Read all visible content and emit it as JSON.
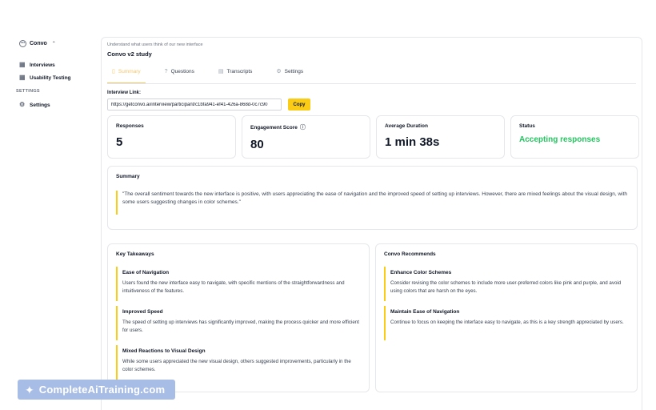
{
  "sidebar": {
    "workspace": "Convo",
    "nav": [
      {
        "label": "Interviews",
        "icon": "grid-icon"
      },
      {
        "label": "Usability Testing",
        "icon": "grid-icon"
      }
    ],
    "section_label": "SETTINGS",
    "settings_item": {
      "label": "Settings",
      "icon": "gear-icon"
    }
  },
  "header": {
    "subtitle": "Understand what users think of our new interface",
    "title": "Convo v2 study"
  },
  "tabs": [
    {
      "label": "Summary",
      "icon": "document-icon",
      "active": true
    },
    {
      "label": "Questions",
      "icon": "question-icon",
      "active": false
    },
    {
      "label": "Transcripts",
      "icon": "file-icon",
      "active": false
    },
    {
      "label": "Settings",
      "icon": "gear-icon",
      "active": false
    }
  ],
  "interview_link": {
    "label": "Interview Link:",
    "value": "https://getconvo.ai/interview/participant/c1bfa941-ef41-426a-868d-0c7c90",
    "copy_label": "Copy"
  },
  "stats": {
    "responses": {
      "label": "Responses",
      "value": "5"
    },
    "engagement": {
      "label": "Engagement Score",
      "value": "80"
    },
    "duration": {
      "label": "Average Duration",
      "value": "1 min 38s"
    },
    "status": {
      "label": "Status",
      "value": "Accepting responses"
    }
  },
  "summary": {
    "title": "Summary",
    "quote": "\"The overall sentiment towards the new interface is positive, with users appreciating the ease of navigation and the improved speed of setting up interviews. However, there are mixed feelings about the visual design, with some users suggesting changes in color schemes.\""
  },
  "takeaways": {
    "title": "Key Takeaways",
    "items": [
      {
        "title": "Ease of Navigation",
        "desc": "Users found the new interface easy to navigate, with specific mentions of the straightforwardness and intuitiveness of the features."
      },
      {
        "title": "Improved Speed",
        "desc": "The speed of setting up interviews has significantly improved, making the process quicker and more efficient for users."
      },
      {
        "title": "Mixed Reactions to Visual Design",
        "desc": "While some users appreciated the new visual design, others suggested improvements, particularly in the color schemes."
      }
    ]
  },
  "recommends": {
    "title": "Convo Recommends",
    "items": [
      {
        "title": "Enhance Color Schemes",
        "desc": "Consider revising the color schemes to include more user-preferred colors like pink and purple, and avoid using colors that are harsh on the eyes."
      },
      {
        "title": "Maintain Ease of Navigation",
        "desc": "Continue to focus on keeping the interface easy to navigate, as this is a key strength appreciated by users."
      }
    ]
  },
  "watermark": "CompleteAiTraining.com",
  "colors": {
    "accent": "#facc15",
    "status_green": "#22c55e",
    "active_tab": "#f5c66a"
  }
}
